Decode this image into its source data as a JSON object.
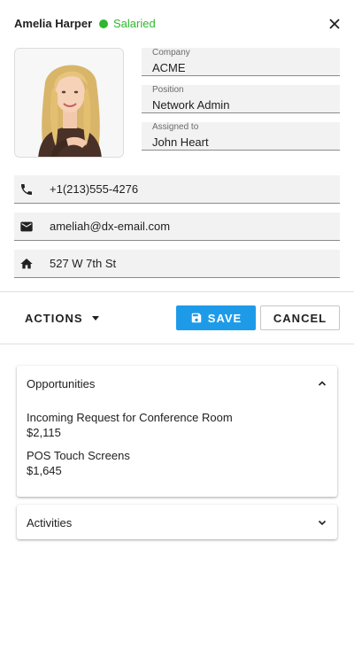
{
  "header": {
    "name": "Amelia Harper",
    "status": "Salaried",
    "status_color": "#2eb82e",
    "close_icon": "close-icon"
  },
  "fields": [
    {
      "label": "Company",
      "value": "ACME"
    },
    {
      "label": "Position",
      "value": "Network Admin"
    },
    {
      "label": "Assigned to",
      "value": "John Heart"
    }
  ],
  "contacts": {
    "phone": {
      "icon": "phone-icon",
      "value": "+1(213)555-4276"
    },
    "email": {
      "icon": "email-icon",
      "value": "ameliah@dx-email.com"
    },
    "address": {
      "icon": "home-icon",
      "value": "527 W 7th St"
    }
  },
  "toolbar": {
    "actions_label": "ACTIONS",
    "save_label": "SAVE",
    "cancel_label": "CANCEL",
    "accent_color": "#1e9be8"
  },
  "opportunities": {
    "title": "Opportunities",
    "expanded": true,
    "items": [
      {
        "name": "Incoming Request for Conference Room",
        "amount": "$2,115"
      },
      {
        "name": "POS Touch Screens",
        "amount": "$1,645"
      }
    ]
  },
  "activities": {
    "title": "Activities",
    "expanded": false
  }
}
